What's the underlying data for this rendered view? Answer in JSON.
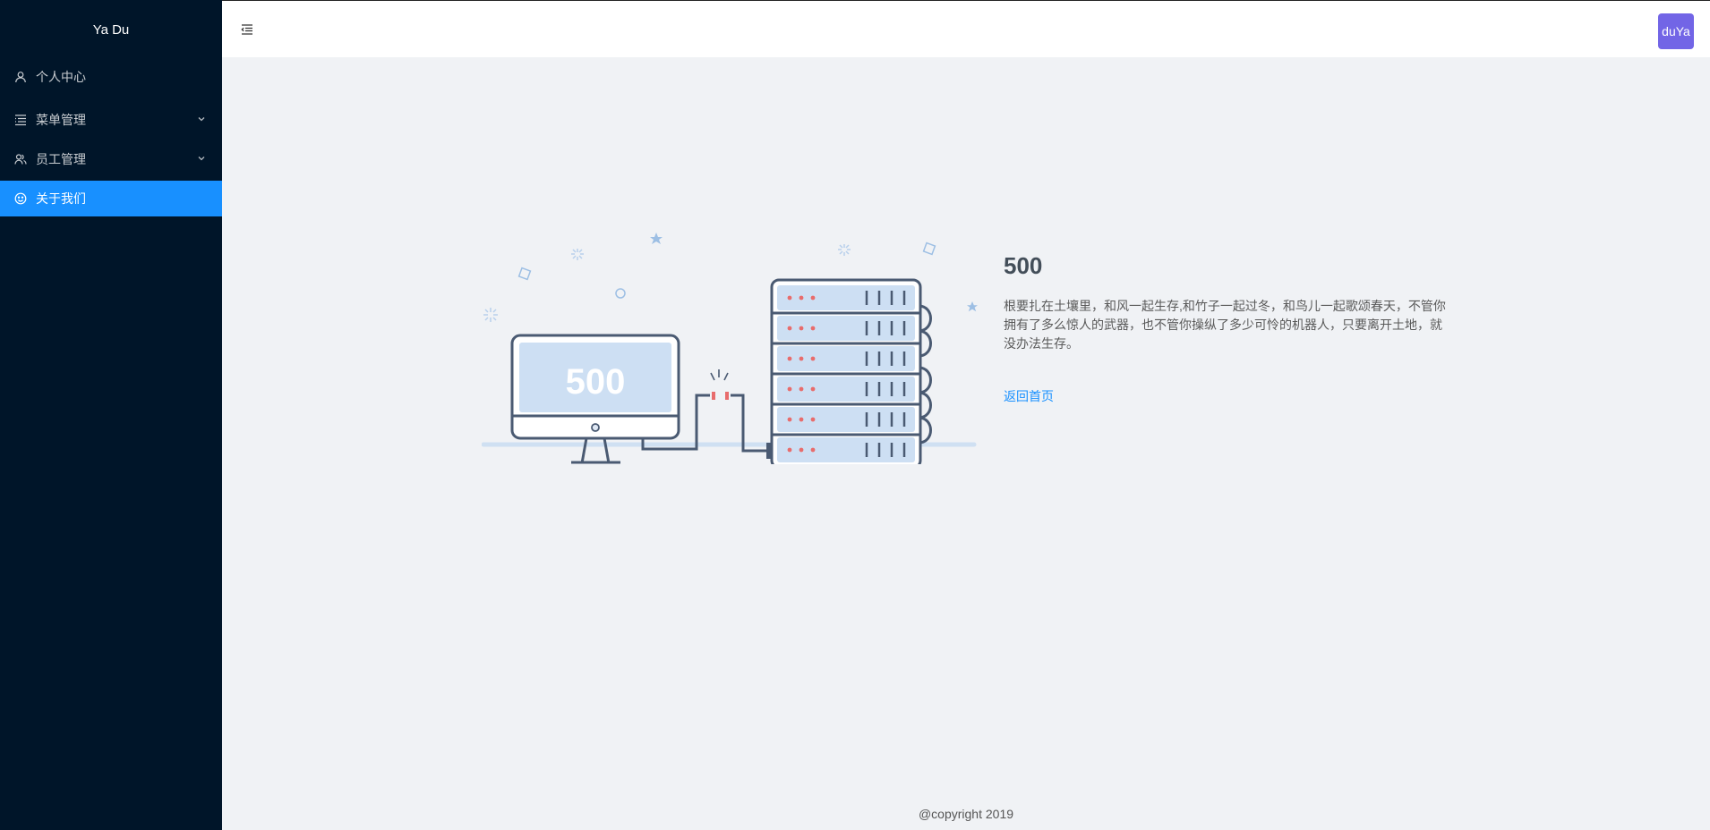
{
  "sidebar": {
    "logo": "Ya Du",
    "items": [
      {
        "label": "个人中心",
        "icon": "user-icon"
      },
      {
        "label": "菜单管理",
        "icon": "menu-list-icon",
        "has_submenu": true
      },
      {
        "label": "员工管理",
        "icon": "team-icon",
        "has_submenu": true
      },
      {
        "label": "关于我们",
        "icon": "smile-icon",
        "active": true
      }
    ]
  },
  "header": {
    "toggle_icon": "menu-fold-icon",
    "avatar_text": "duYa"
  },
  "error": {
    "code": "500",
    "illustration_text": "500",
    "description": "根要扎在土壤里，和风一起生存,和竹子一起过冬，和鸟儿一起歌颂春天，不管你拥有了多么惊人的武器，也不管你操纵了多少可怜的机器人，只要离开土地，就没办法生存。",
    "back_link": "返回首页"
  },
  "footer": {
    "copyright": "@copyright 2019"
  },
  "colors": {
    "sidebar_bg": "#001529",
    "active_item": "#1890ff",
    "avatar_bg": "#7265e6",
    "page_bg": "#f0f2f5"
  }
}
